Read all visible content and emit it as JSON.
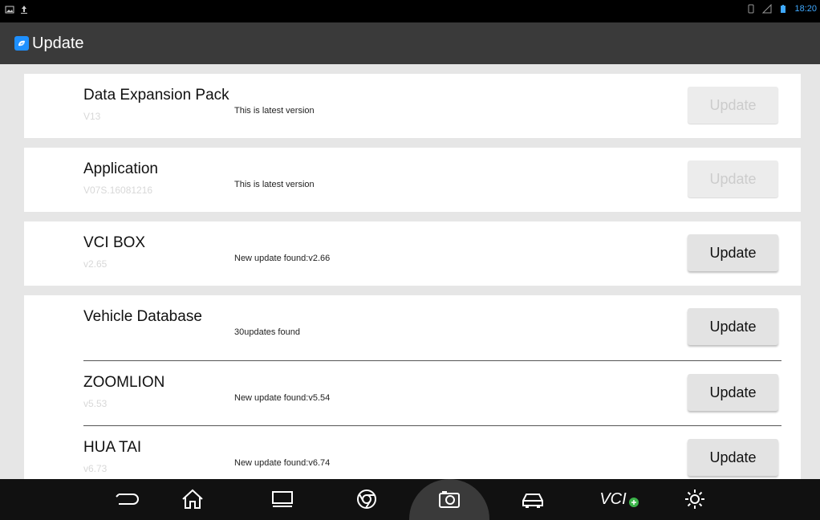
{
  "statusbar": {
    "time": "18:20",
    "left_icons": [
      "picture-icon",
      "upload-icon"
    ],
    "right_icons": [
      "sim-icon",
      "no-signal-icon",
      "battery-icon"
    ]
  },
  "appbar": {
    "title": "Update"
  },
  "update_items": [
    {
      "name": "Data Expansion Pack",
      "version": "V13",
      "status": "This is latest version",
      "button": "Update",
      "enabled": false
    },
    {
      "name": "Application",
      "version": "V07S.16081216",
      "status": "This is latest version",
      "button": "Update",
      "enabled": false
    },
    {
      "name": "VCI BOX",
      "version": "v2.65",
      "status": "New update found:v2.66",
      "button": "Update",
      "enabled": true
    },
    {
      "name": "Vehicle Database",
      "version": "",
      "status": "30updates found",
      "button": "Update",
      "enabled": true
    },
    {
      "name": "ZOOMLION",
      "version": "v5.53",
      "status": "New update found:v5.54",
      "button": "Update",
      "enabled": true
    },
    {
      "name": "HUA TAI",
      "version": "v6.73",
      "status": "New update found:v6.74",
      "button": "Update",
      "enabled": true
    }
  ],
  "navbar": {
    "vci_label": "VCI",
    "items": [
      "back-icon",
      "home-icon",
      "recent-apps-icon",
      "browser-icon",
      "camera-icon",
      "car-icon",
      "vci-icon",
      "settings-icon"
    ],
    "active": "camera-icon"
  },
  "colors": {
    "appbar": "#3a3a3a",
    "accent": "#1e90ff",
    "vci_dot": "#3cb34a"
  }
}
